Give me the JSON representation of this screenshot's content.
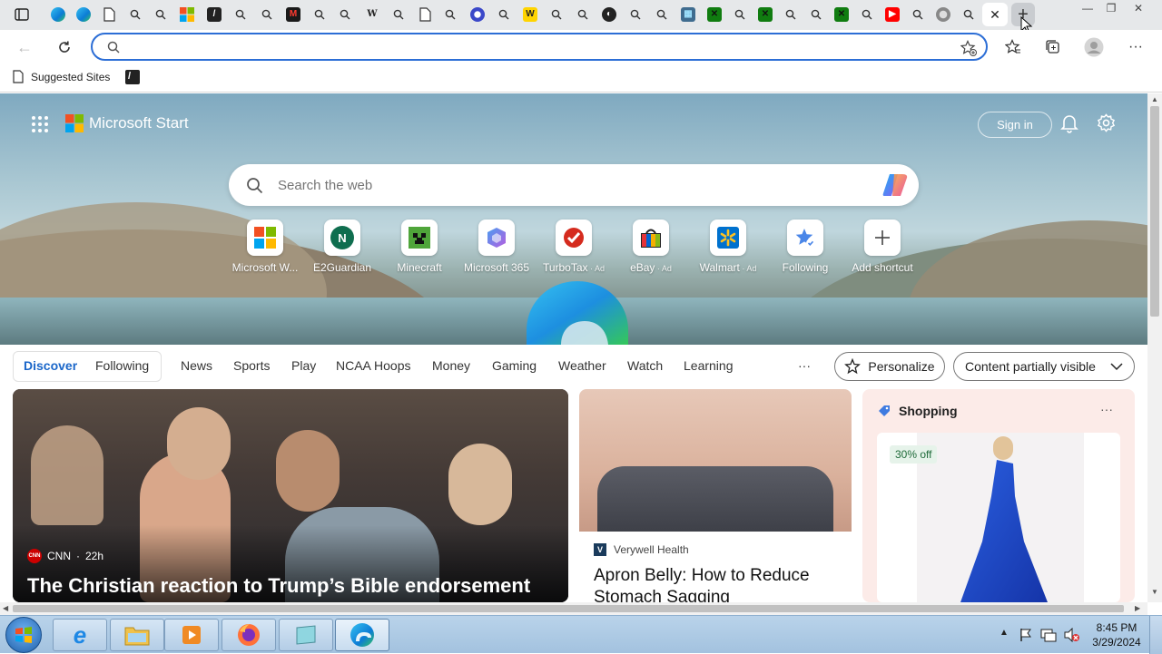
{
  "browser": {
    "tabs": [
      {
        "icon": "sidebar-tab-icon"
      },
      {
        "icon": "edge-icon"
      },
      {
        "icon": "edge-icon"
      },
      {
        "icon": "page-icon"
      },
      {
        "icon": "search-icon"
      },
      {
        "icon": "search-icon"
      },
      {
        "icon": "microsoft-icon"
      },
      {
        "icon": "tile-icon"
      },
      {
        "icon": "search-icon"
      },
      {
        "icon": "search-icon"
      },
      {
        "icon": "news-icon"
      },
      {
        "icon": "search-icon"
      },
      {
        "icon": "search-icon"
      },
      {
        "icon": "wikipedia-icon"
      },
      {
        "icon": "search-icon"
      },
      {
        "icon": "page-icon"
      },
      {
        "icon": "search-icon"
      },
      {
        "icon": "circle-icon"
      },
      {
        "icon": "search-icon"
      },
      {
        "icon": "w-icon"
      },
      {
        "icon": "search-icon"
      },
      {
        "icon": "search-icon"
      },
      {
        "icon": "npr-icon"
      },
      {
        "icon": "search-icon"
      },
      {
        "icon": "search-icon"
      },
      {
        "icon": "app-icon"
      },
      {
        "icon": "xbox-icon"
      },
      {
        "icon": "search-icon"
      },
      {
        "icon": "xbox-icon"
      },
      {
        "icon": "search-icon"
      },
      {
        "icon": "search-icon"
      },
      {
        "icon": "xbox-icon"
      },
      {
        "icon": "search-icon"
      },
      {
        "icon": "youtube-icon"
      },
      {
        "icon": "search-icon"
      },
      {
        "icon": "gray-circle-icon"
      },
      {
        "icon": "search-icon"
      },
      {
        "icon": "new-tab-page-icon"
      }
    ],
    "address": {
      "value": "",
      "placeholder": ""
    },
    "favorites": {
      "suggested_sites": "Suggested Sites"
    }
  },
  "page": {
    "brand": "Microsoft Start",
    "sign_in": "Sign in",
    "search": {
      "placeholder": "Search the web"
    },
    "shortcuts": [
      {
        "label": "Microsoft W...",
        "ad": ""
      },
      {
        "label": "E2Guardian",
        "ad": "",
        "letter": "N"
      },
      {
        "label": "Minecraft",
        "ad": ""
      },
      {
        "label": "Microsoft 365",
        "ad": ""
      },
      {
        "label": "TurboTax",
        "ad": "Ad"
      },
      {
        "label": "eBay",
        "ad": "Ad"
      },
      {
        "label": "Walmart",
        "ad": "Ad"
      },
      {
        "label": "Following",
        "ad": ""
      },
      {
        "label": "Add shortcut",
        "ad": ""
      }
    ],
    "nav": {
      "discover": "Discover",
      "following": "Following",
      "items": [
        "News",
        "Sports",
        "Play",
        "NCAA Hoops",
        "Money",
        "Gaming",
        "Weather",
        "Watch",
        "Learning"
      ],
      "more": "···",
      "personalize": "Personalize",
      "content_visibility": "Content partially visible"
    },
    "cards": {
      "main": {
        "source": "CNN",
        "age": "22h",
        "headline": "The Christian reaction to Trump’s Bible endorsement",
        "source_badge": "CNN"
      },
      "second": {
        "source": "Verywell Health",
        "headline": "Apron Belly: How to Reduce Stomach Sagging"
      },
      "shopping": {
        "title": "Shopping",
        "discount": "30% off",
        "more": "···"
      }
    }
  },
  "taskbar": {
    "time": "8:45 PM",
    "date": "3/29/2024"
  },
  "colors": {
    "accent": "#2c6ed6",
    "edge_blue": "#0c7cd5",
    "taskbar": "#b9d3ea"
  }
}
